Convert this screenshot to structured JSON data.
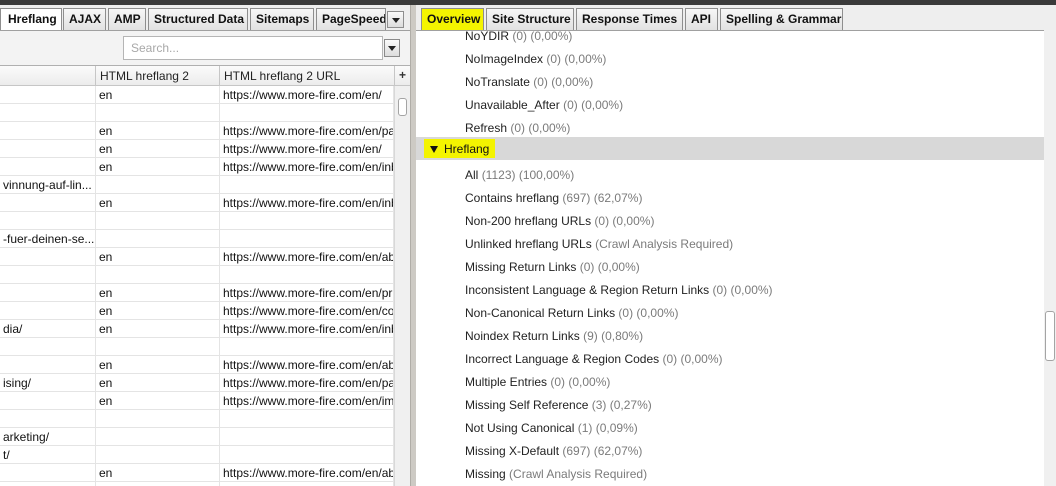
{
  "left_pane": {
    "tabs": [
      "Hreflang",
      "AJAX",
      "AMP",
      "Structured Data",
      "Sitemaps",
      "PageSpeed"
    ],
    "search": {
      "placeholder": "Search..."
    },
    "columns": [
      "",
      "HTML hreflang 2",
      "HTML hreflang 2 URL"
    ],
    "rows": [
      [
        "",
        "en",
        "https://www.more-fire.com/en/"
      ],
      [
        "",
        "",
        ""
      ],
      [
        "",
        "en",
        "https://www.more-fire.com/en/pa"
      ],
      [
        "",
        "en",
        "https://www.more-fire.com/en/"
      ],
      [
        "",
        "en",
        "https://www.more-fire.com/en/inb"
      ],
      [
        "vinnung-auf-lin...",
        "",
        ""
      ],
      [
        "",
        "en",
        "https://www.more-fire.com/en/inb"
      ],
      [
        "",
        "",
        ""
      ],
      [
        "-fuer-deinen-se...",
        "",
        ""
      ],
      [
        "",
        "en",
        "https://www.more-fire.com/en/ab"
      ],
      [
        "",
        "",
        ""
      ],
      [
        "",
        "en",
        "https://www.more-fire.com/en/pri"
      ],
      [
        "",
        "en",
        "https://www.more-fire.com/en/co"
      ],
      [
        "dia/",
        "en",
        "https://www.more-fire.com/en/inb"
      ],
      [
        "",
        "",
        ""
      ],
      [
        "",
        "en",
        "https://www.more-fire.com/en/ab"
      ],
      [
        "ising/",
        "en",
        "https://www.more-fire.com/en/pa"
      ],
      [
        "",
        "en",
        "https://www.more-fire.com/en/im"
      ],
      [
        "",
        "",
        ""
      ],
      [
        "arketing/",
        "",
        ""
      ],
      [
        "t/",
        "",
        ""
      ],
      [
        "",
        "en",
        "https://www.more-fire.com/en/ab"
      ],
      [
        "",
        "en",
        "https://www.more-fire.com/en/ab"
      ]
    ]
  },
  "right_pane": {
    "tabs": [
      "Overview",
      "Site Structure",
      "Response Times",
      "API",
      "Spelling & Grammar"
    ],
    "items_before": [
      {
        "label": "NoYDIR",
        "count": "(0) (0,00%)"
      },
      {
        "label": "NoImageIndex",
        "count": "(0) (0,00%)"
      },
      {
        "label": "NoTranslate",
        "count": "(0) (0,00%)"
      },
      {
        "label": "Unavailable_After",
        "count": "(0) (0,00%)"
      },
      {
        "label": "Refresh",
        "count": "(0) (0,00%)"
      }
    ],
    "group": {
      "label": "Hreflang"
    },
    "group_items": [
      {
        "label": "All",
        "count": "(1123) (100,00%)"
      },
      {
        "label": "Contains hreflang",
        "count": "(697) (62,07%)"
      },
      {
        "label": "Non-200 hreflang URLs",
        "count": "(0) (0,00%)"
      },
      {
        "label": "Unlinked hreflang URLs",
        "count": "(Crawl Analysis Required)"
      },
      {
        "label": "Missing Return Links",
        "count": "(0) (0,00%)"
      },
      {
        "label": "Inconsistent Language & Region Return Links",
        "count": "(0) (0,00%)"
      },
      {
        "label": "Non-Canonical Return Links",
        "count": "(0) (0,00%)"
      },
      {
        "label": "Noindex Return Links",
        "count": "(9) (0,80%)"
      },
      {
        "label": "Incorrect Language & Region Codes",
        "count": "(0) (0,00%)"
      },
      {
        "label": "Multiple Entries",
        "count": "(0) (0,00%)"
      },
      {
        "label": "Missing Self Reference",
        "count": "(3) (0,27%)"
      },
      {
        "label": "Not Using Canonical",
        "count": "(1) (0,09%)"
      },
      {
        "label": "Missing X-Default",
        "count": "(697) (62,07%)"
      },
      {
        "label": "Missing",
        "count": "(Crawl Analysis Required)"
      }
    ]
  }
}
